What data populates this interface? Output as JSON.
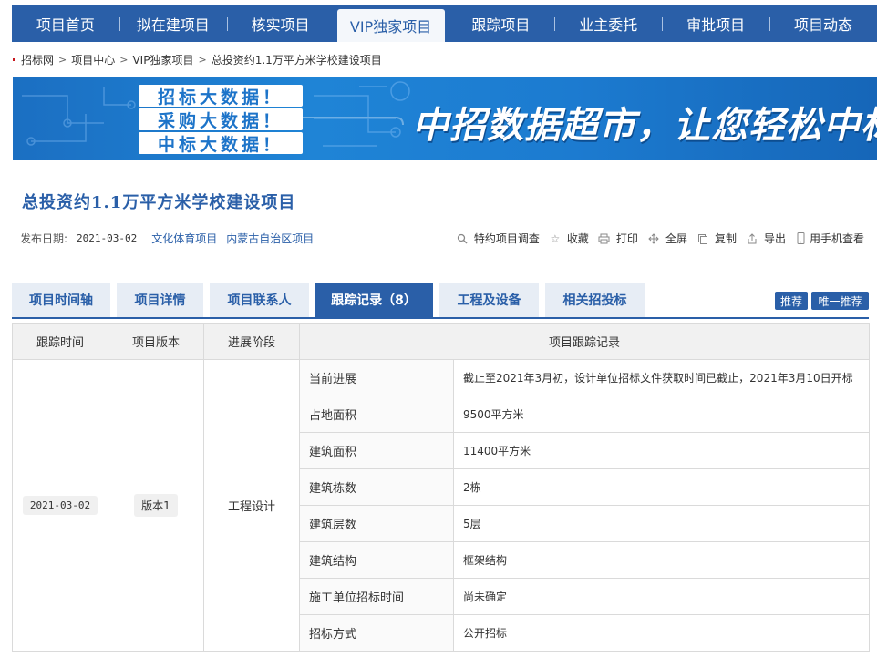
{
  "nav": {
    "items": [
      "项目首页",
      "拟在建项目",
      "核实项目",
      "VIP独家项目",
      "跟踪项目",
      "业主委托",
      "审批项目",
      "项目动态"
    ],
    "active_index": 3
  },
  "breadcrumb": [
    "招标网",
    "项目中心",
    "VIP独家项目",
    "总投资约1.1万平方米学校建设项目"
  ],
  "banner": {
    "tags": [
      "招标大数据！",
      "采购大数据！",
      "中标大数据！"
    ],
    "slogan": "中招数据超市，让您轻松中标"
  },
  "project": {
    "title": "总投资约1.1万平方米学校建设项目",
    "date_label": "发布日期:",
    "date": "2021-03-02",
    "categories": [
      "文化体育项目",
      "内蒙古自治区项目"
    ]
  },
  "tools": [
    {
      "icon": "search-icon",
      "label": "特约项目调查"
    },
    {
      "icon": "star-icon",
      "label": "收藏"
    },
    {
      "icon": "printer-icon",
      "label": "打印"
    },
    {
      "icon": "fullscreen-icon",
      "label": "全屏"
    },
    {
      "icon": "copy-icon",
      "label": "复制"
    },
    {
      "icon": "export-icon",
      "label": "导出"
    },
    {
      "icon": "phone-icon",
      "label": "用手机查看"
    }
  ],
  "tabs": [
    "项目时间轴",
    "项目详情",
    "项目联系人",
    "跟踪记录（8）",
    "工程及设备",
    "相关招投标"
  ],
  "active_tab": 3,
  "tab_buttons": [
    "推荐",
    "唯一推荐"
  ],
  "table": {
    "headers": [
      "跟踪时间",
      "项目版本",
      "进展阶段",
      "项目跟踪记录"
    ],
    "date": "2021-03-02",
    "version": "版本1",
    "stage": "工程设计",
    "rows": [
      {
        "key": "当前进展",
        "value": "截止至2021年3月初，设计单位招标文件获取时间已截止，2021年3月10日开标"
      },
      {
        "key": "占地面积",
        "value": "9500平方米"
      },
      {
        "key": "建筑面积",
        "value": "11400平方米"
      },
      {
        "key": "建筑栋数",
        "value": "2栋"
      },
      {
        "key": "建筑层数",
        "value": "5层"
      },
      {
        "key": "建筑结构",
        "value": "框架结构"
      },
      {
        "key": "施工单位招标时间",
        "value": "尚未确定"
      },
      {
        "key": "招标方式",
        "value": "公开招标"
      }
    ]
  },
  "colors": {
    "primary": "#2a5fa8",
    "accent_red": "#c8161d"
  }
}
